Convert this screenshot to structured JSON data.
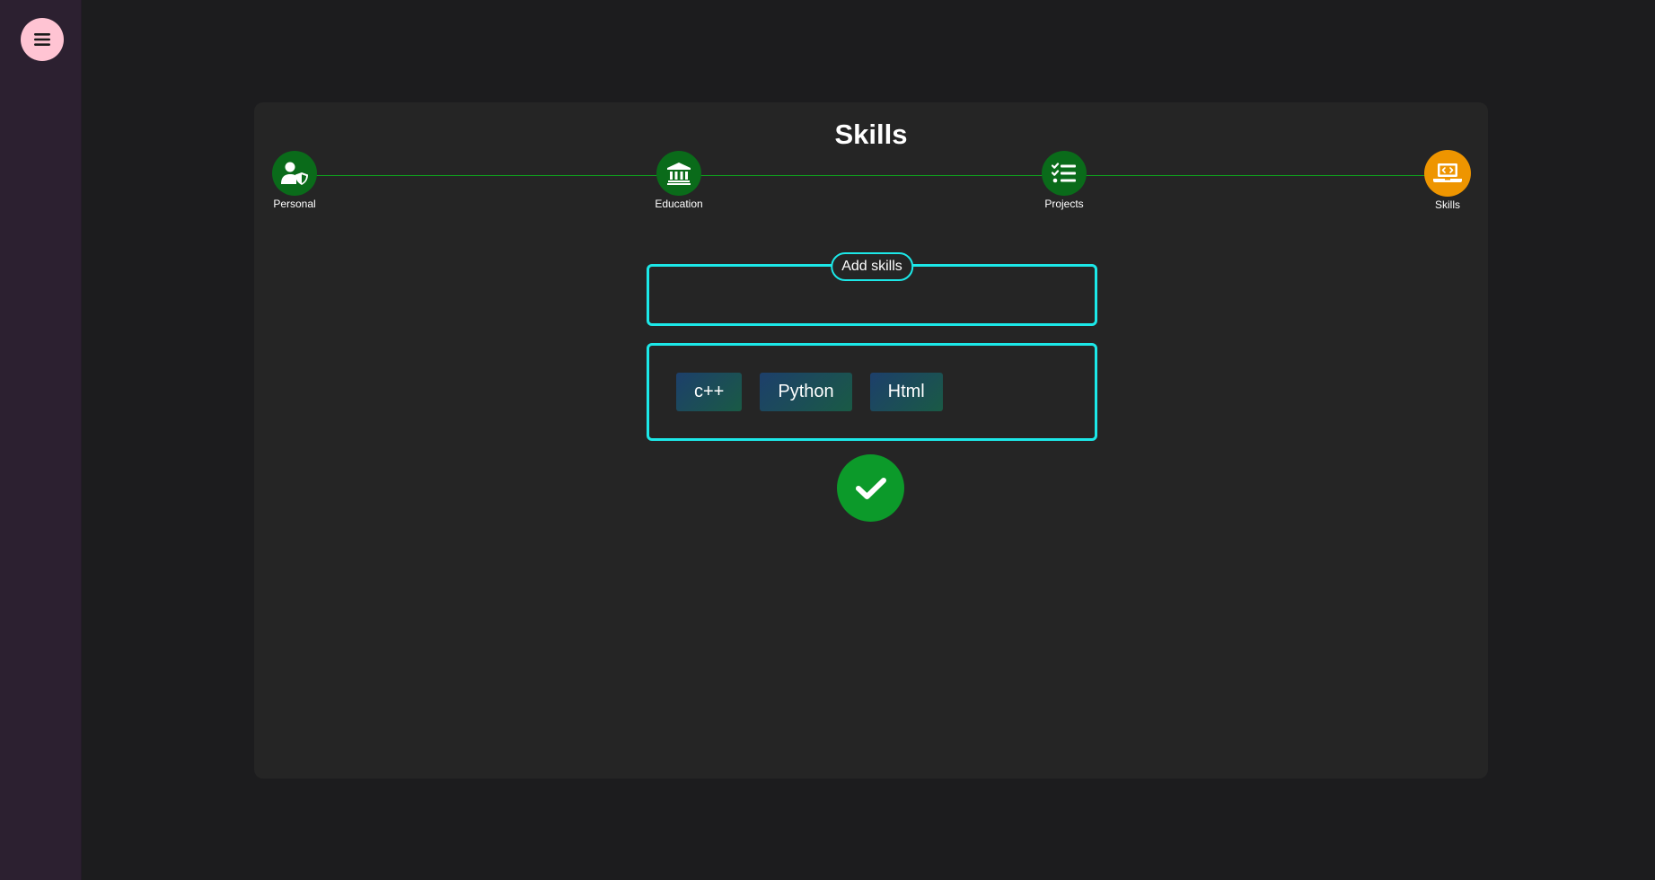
{
  "app": {
    "menu_icon": "hamburger-menu-icon"
  },
  "page": {
    "title": "Skills"
  },
  "steps": [
    {
      "label": "Personal",
      "icon": "user-shield-icon",
      "status": "completed"
    },
    {
      "label": "Education",
      "icon": "institution-icon",
      "status": "completed"
    },
    {
      "label": "Projects",
      "icon": "checklist-icon",
      "status": "completed"
    },
    {
      "label": "Skills",
      "icon": "laptop-code-icon",
      "status": "active"
    }
  ],
  "add_skills": {
    "legend": "Add skills",
    "value": ""
  },
  "skills": [
    "c++",
    "Python",
    "Html"
  ],
  "actions": {
    "confirm_icon": "checkmark-icon"
  },
  "colors": {
    "completed_step": "#0a6b1a",
    "active_step": "#ee9500",
    "accent_border": "#1ce8e8",
    "confirm": "#0c9a2a",
    "menu_button": "#ffc4d3",
    "sidebar": "#2c2030"
  }
}
